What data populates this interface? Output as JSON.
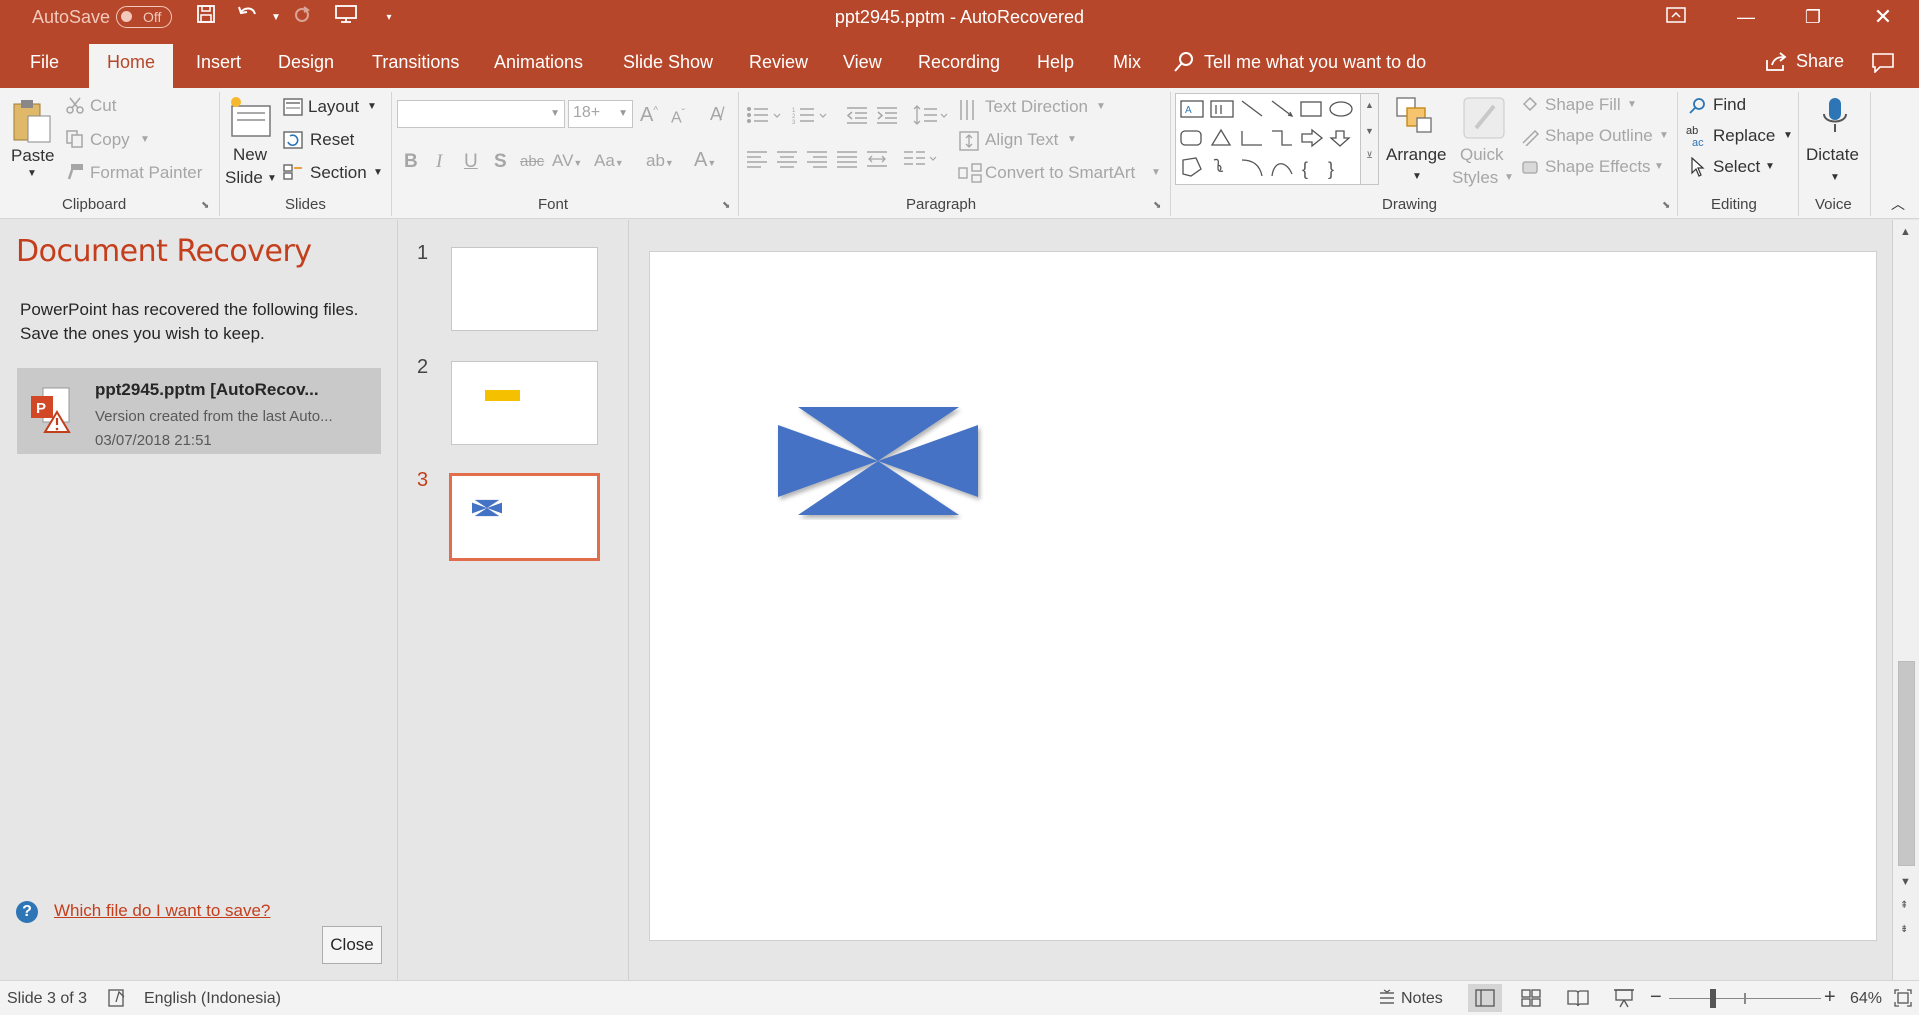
{
  "titlebar": {
    "autosave_label": "AutoSave",
    "autosave_state": "Off",
    "document_title": "ppt2945.pptm  -  AutoRecovered"
  },
  "tabs": [
    "File",
    "Home",
    "Insert",
    "Design",
    "Transitions",
    "Animations",
    "Slide Show",
    "Review",
    "View",
    "Recording",
    "Help",
    "Mix"
  ],
  "active_tab": "Home",
  "tell_me": "Tell me what you want to do",
  "share_label": "Share",
  "ribbon": {
    "clipboard": {
      "label": "Clipboard",
      "paste": "Paste",
      "cut": "Cut",
      "copy": "Copy",
      "format_painter": "Format Painter"
    },
    "slides": {
      "label": "Slides",
      "new_slide_1": "New",
      "new_slide_2": "Slide",
      "layout": "Layout",
      "reset": "Reset",
      "section": "Section"
    },
    "font": {
      "label": "Font",
      "font_name": "",
      "font_size": "18+"
    },
    "paragraph": {
      "label": "Paragraph",
      "text_direction": "Text Direction",
      "align_text": "Align Text",
      "convert_smartart": "Convert to SmartArt"
    },
    "drawing": {
      "label": "Drawing",
      "arrange": "Arrange",
      "quick_styles_1": "Quick",
      "quick_styles_2": "Styles",
      "shape_fill": "Shape Fill",
      "shape_outline": "Shape Outline",
      "shape_effects": "Shape Effects"
    },
    "editing": {
      "label": "Editing",
      "find": "Find",
      "replace": "Replace",
      "select": "Select"
    },
    "voice": {
      "label": "Voice",
      "dictate": "Dictate"
    }
  },
  "recovery": {
    "title": "Document Recovery",
    "description_line1": "PowerPoint has recovered the following files.",
    "description_line2": "Save the ones you wish to keep.",
    "item": {
      "name": "ppt2945.pptm  [AutoRecov...",
      "version": "Version created from the last Auto...",
      "date": "03/07/2018 21:51"
    },
    "help_link": "Which file do I want to save?",
    "close_label": "Close"
  },
  "thumbnails": [
    {
      "number": "1"
    },
    {
      "number": "2"
    },
    {
      "number": "3"
    }
  ],
  "current_slide_index": 3,
  "status": {
    "slide_info": "Slide 3 of 3",
    "language": "English (Indonesia)",
    "notes": "Notes",
    "zoom": "64%"
  },
  "colors": {
    "accent": "#b7472a",
    "shape_fill": "#4472c4",
    "thumb_highlight": "#e26d4b"
  }
}
